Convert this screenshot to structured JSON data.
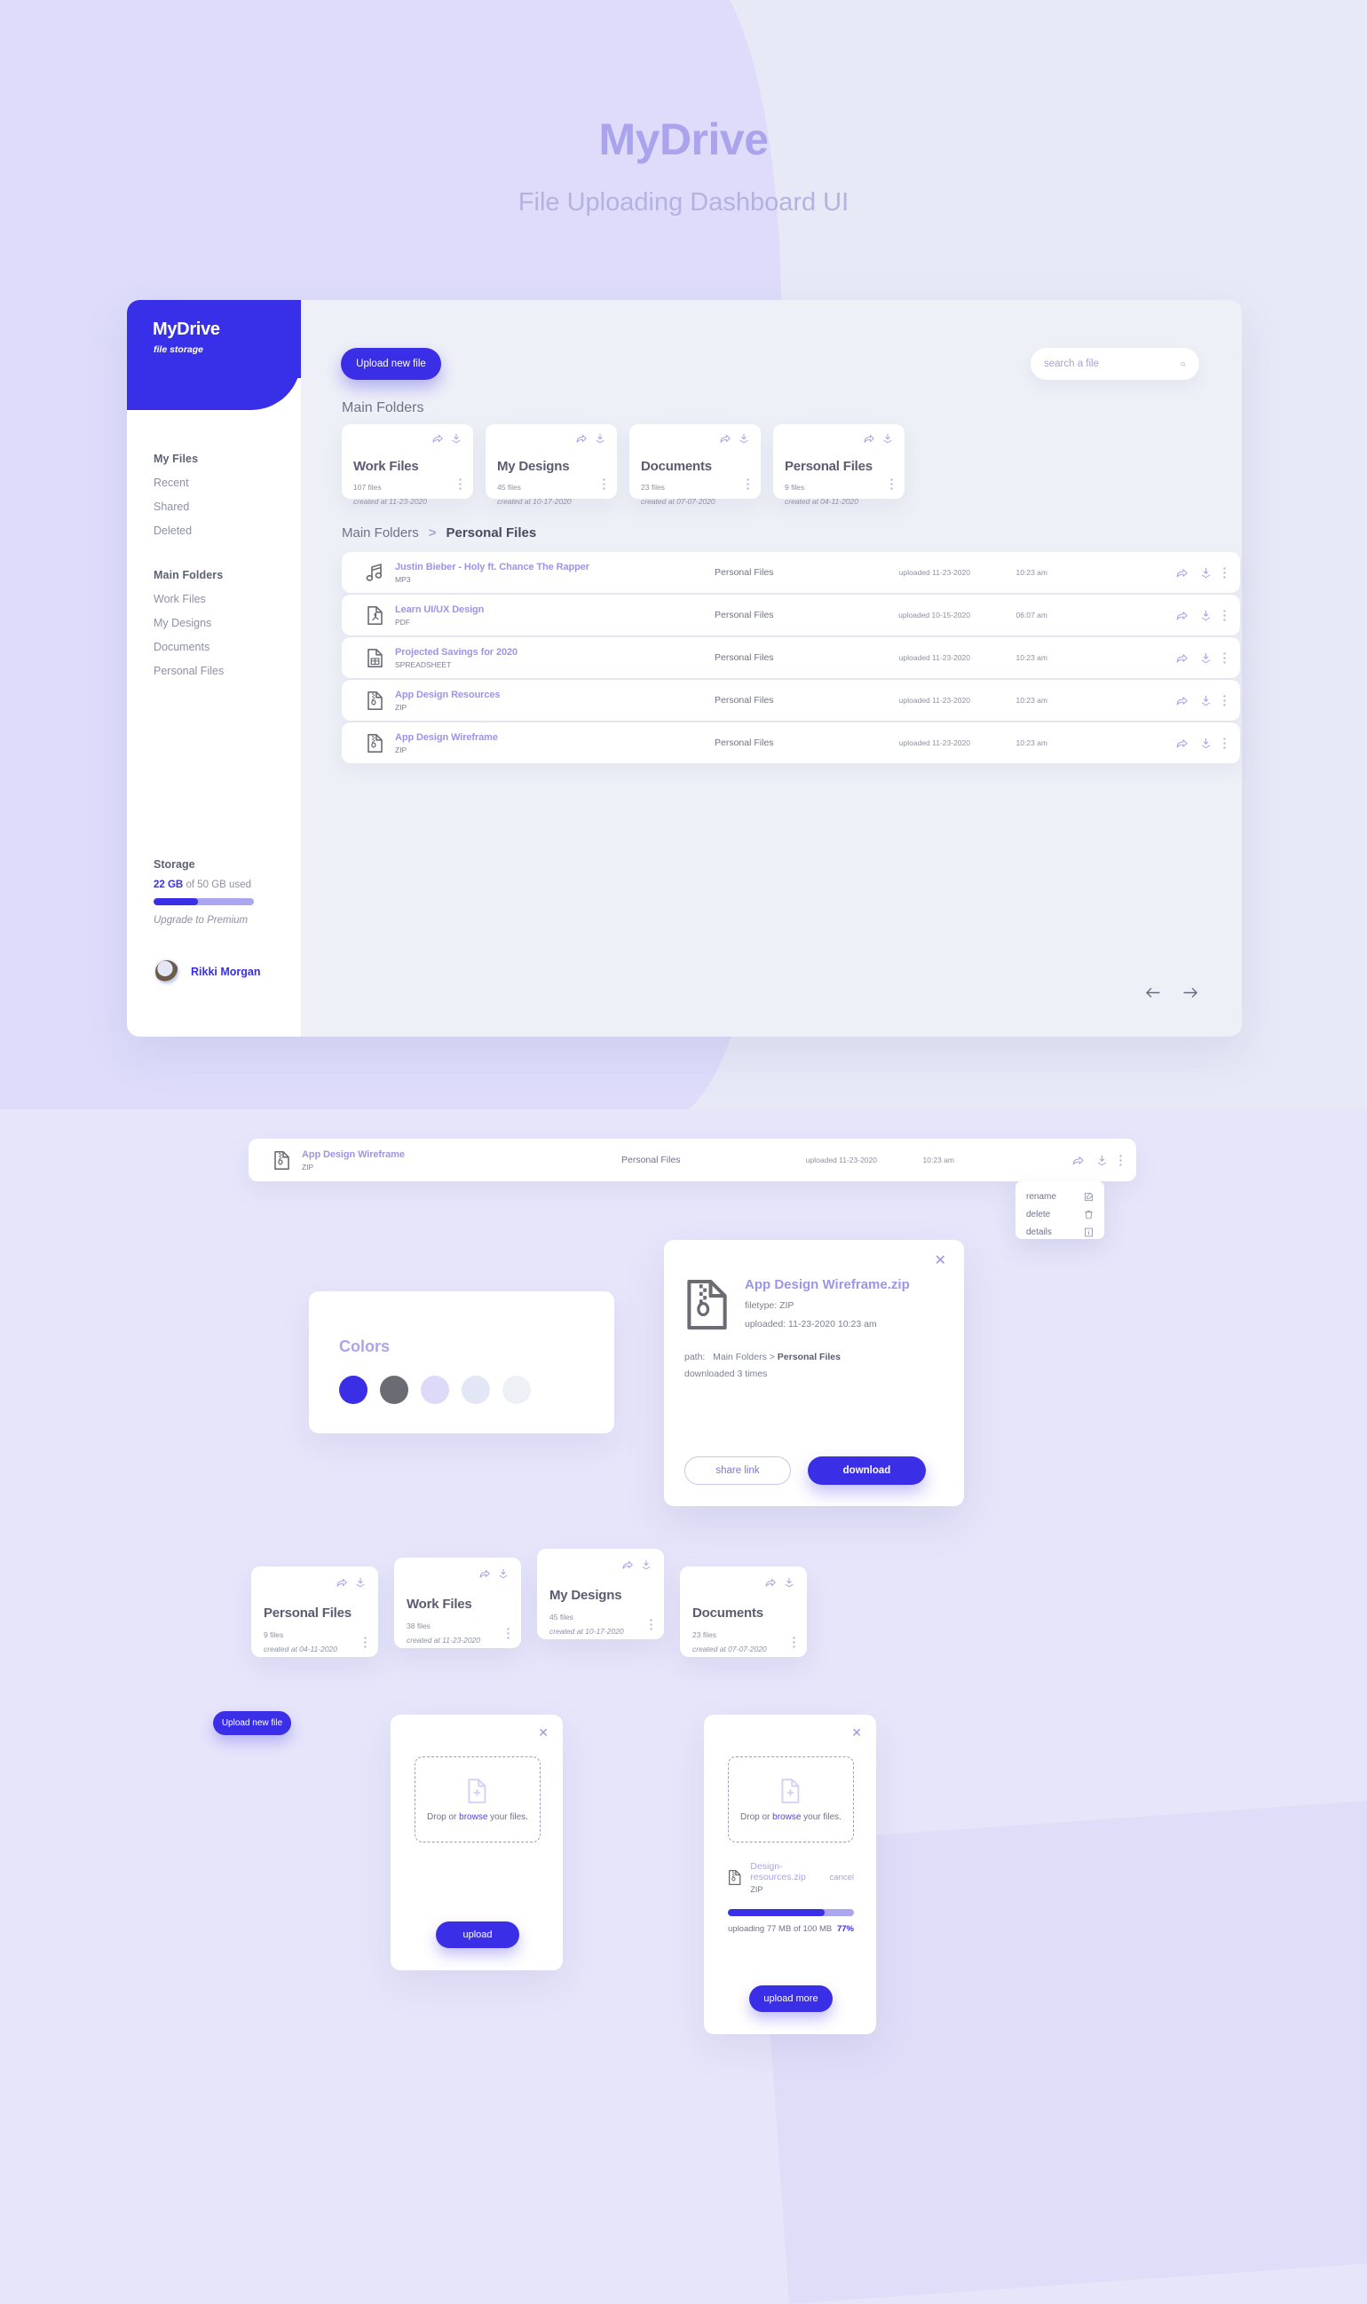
{
  "page": {
    "brand_title": "MyDrive",
    "brand_subtitle": "File Uploading Dashboard UI"
  },
  "sidebar": {
    "logo": "MyDrive",
    "logo_sub": "file storage",
    "my_files_heading": "My Files",
    "my_files_items": [
      "Recent",
      "Shared",
      "Deleted"
    ],
    "main_folders_heading": "Main Folders",
    "main_folders_items": [
      "Work Files",
      "My Designs",
      "Documents",
      "Personal Files"
    ],
    "storage": {
      "heading": "Storage",
      "used": "22 GB",
      "of_text": " of 50 GB used",
      "percent": 44,
      "upgrade": "Upgrade to Premium"
    },
    "user": {
      "name": "Rikki Morgan",
      "avatar": "user-avatar"
    }
  },
  "toolbar": {
    "upload_new_label": "Upload new file",
    "search_placeholder": "search a file",
    "search_value": "",
    "search_icon": "search-icon"
  },
  "main": {
    "section_label": "Main Folders",
    "breadcrumb": {
      "root": "Main Folders",
      "separator": ">",
      "current": "Personal Files"
    },
    "folders": [
      {
        "title": "Work Files",
        "files": "107 files",
        "created": "created at 11-23-2020"
      },
      {
        "title": "My Designs",
        "files": "45 files",
        "created": "created at 10-17-2020"
      },
      {
        "title": "Documents",
        "files": "23 files",
        "created": "created at 07-07-2020"
      },
      {
        "title": "Personal Files",
        "files": "9 files",
        "created": "created at 04-11-2020"
      }
    ],
    "files": [
      {
        "name": "Justin Bieber - Holy ft. Chance The Rapper",
        "type": "MP3",
        "icon": "music-file-icon",
        "folder": "Personal Files",
        "uploaded": "uploaded 11-23-2020",
        "time": "10:23 am"
      },
      {
        "name": "Learn UI/UX Design",
        "type": "PDF",
        "icon": "pdf-file-icon",
        "folder": "Personal Files",
        "uploaded": "uploaded 10-15-2020",
        "time": "06:07 am"
      },
      {
        "name": "Projected Savings for 2020",
        "type": "SPREADSHEET",
        "icon": "spreadsheet-file-icon",
        "folder": "Personal Files",
        "uploaded": "uploaded 11-23-2020",
        "time": "10:23 am"
      },
      {
        "name": "App Design Resources",
        "type": "ZIP",
        "icon": "zip-file-icon",
        "folder": "Personal Files",
        "uploaded": "uploaded 11-23-2020",
        "time": "10:23 am"
      },
      {
        "name": "App Design Wireframe",
        "type": "ZIP",
        "icon": "zip-file-icon",
        "folder": "Personal Files",
        "uploaded": "uploaded 11-23-2020",
        "time": "10:23 am"
      }
    ],
    "pager": {
      "prev_icon": "arrow-left-icon",
      "next_icon": "arrow-right-icon"
    }
  },
  "context_demo": {
    "row": {
      "name": "App Design Wireframe",
      "type": "ZIP",
      "folder": "Personal Files",
      "uploaded": "uploaded 11-23-2020",
      "time": "10:23 am"
    },
    "menu": [
      {
        "label": "rename",
        "icon": "edit-icon"
      },
      {
        "label": "delete",
        "icon": "trash-icon"
      },
      {
        "label": "details",
        "icon": "info-icon"
      }
    ]
  },
  "details_modal": {
    "close_icon": "close-icon",
    "file_icon": "zip-file-icon",
    "title": "App Design Wireframe.zip",
    "filetype": "filetype: ZIP",
    "uploaded": "uploaded: 11-23-2020 10:23 am",
    "path_label": "path:",
    "path_root": "Main Folders > ",
    "path_current": "Personal Files",
    "downloads": "downloaded 3 times",
    "share_label": "share link",
    "download_label": "download"
  },
  "colors_panel": {
    "title": "Colors",
    "swatches": [
      "#3a2fe6",
      "#6b6b73",
      "#ddd9f8",
      "#e3e6f5",
      "#eef0f5"
    ]
  },
  "bottom_folders": [
    {
      "title": "Personal Files",
      "files": "9 files",
      "created": "created at 04-11-2020"
    },
    {
      "title": "Work Files",
      "files": "38 files",
      "created": "created at 11-23-2020"
    },
    {
      "title": "My Designs",
      "files": "45 files",
      "created": "created at 10-17-2020"
    },
    {
      "title": "Documents",
      "files": "23 files",
      "created": "created at 07-07-2020"
    }
  ],
  "upload_modal_1": {
    "tag_label": "Upload new file",
    "close_icon": "close-icon",
    "drop_prefix": "Drop or ",
    "drop_browse": "browse",
    "drop_suffix": " your files.",
    "upload_label": "upload"
  },
  "upload_modal_2": {
    "close_icon": "close-icon",
    "drop_prefix": "Drop or ",
    "drop_browse": "browse",
    "drop_suffix": " your files.",
    "file_name": "Design-resources.zip",
    "file_type": "ZIP",
    "cancel_label": "cancel",
    "progress_percent": 77,
    "status_text": "uploading 77 MB of 100 MB",
    "percent_label": "77%",
    "upload_more_label": "upload more"
  }
}
